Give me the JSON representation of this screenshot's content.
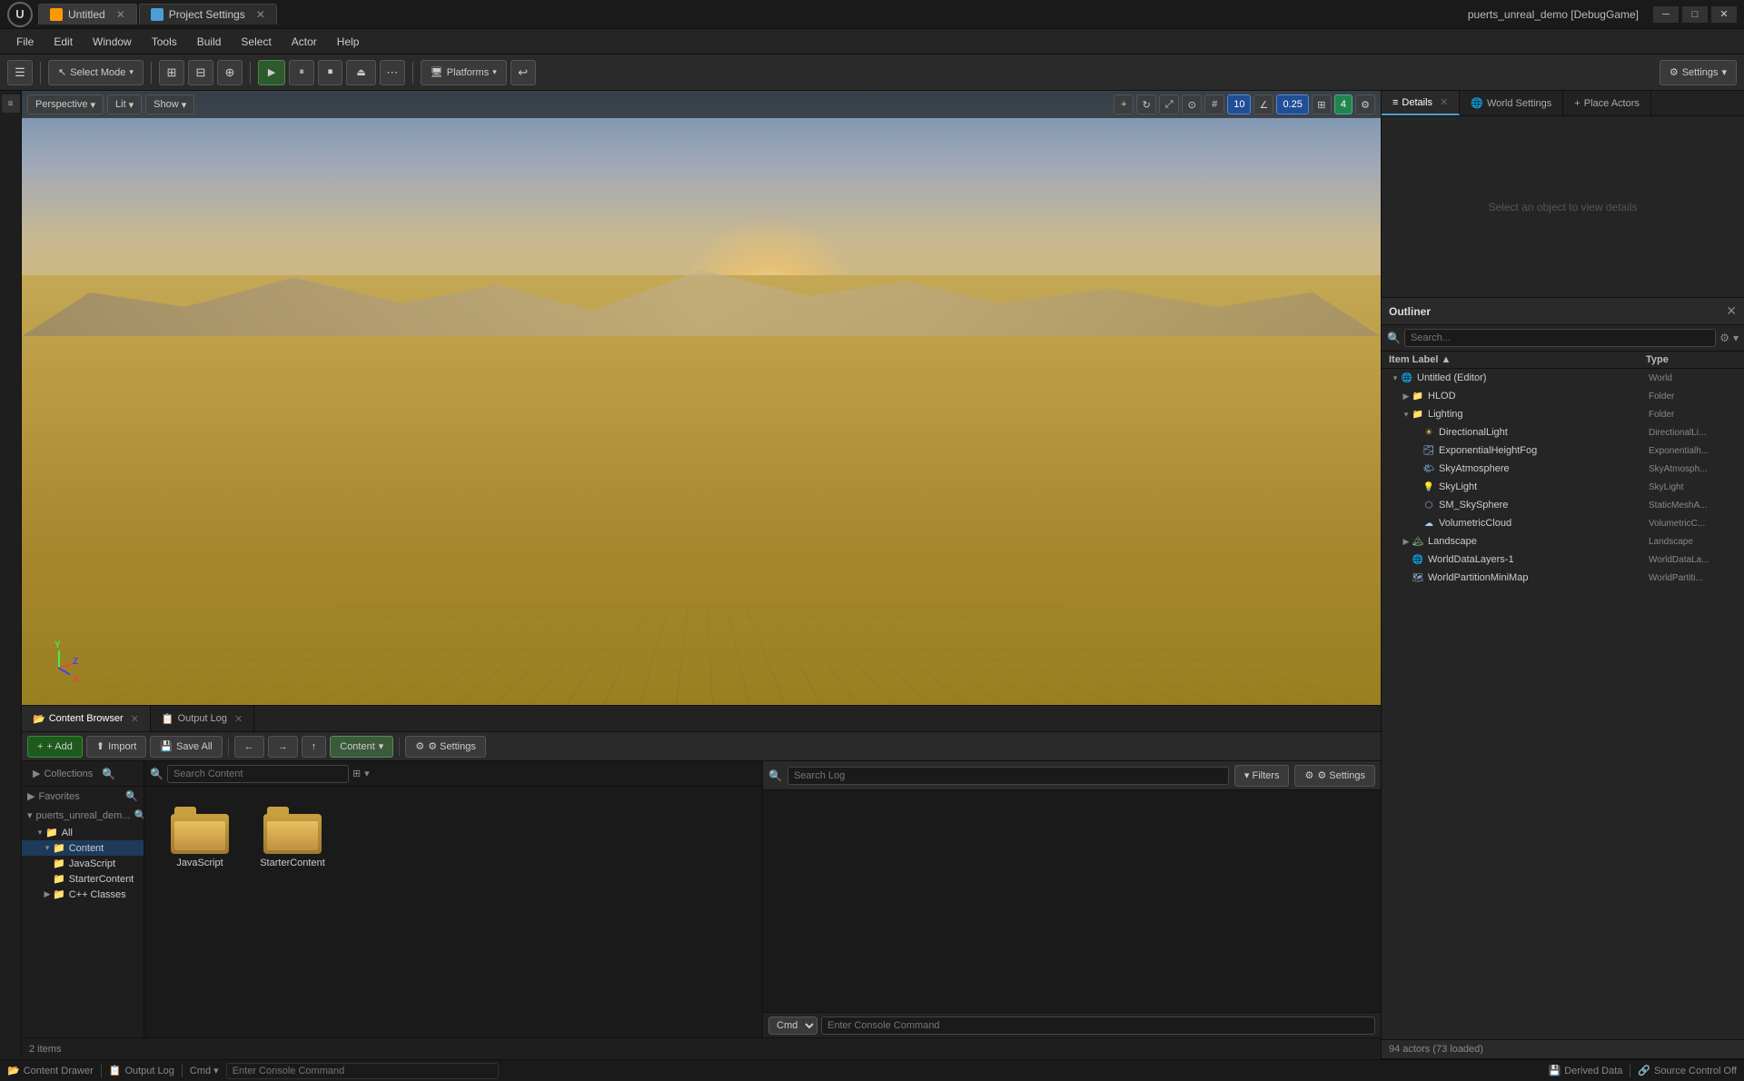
{
  "titlebar": {
    "logo": "U",
    "app_title": "puerts_unreal_demo [DebugGame]",
    "tabs": [
      {
        "label": "Untitled",
        "icon": "orange",
        "active": true
      },
      {
        "label": "Project Settings",
        "icon": "blue",
        "active": false
      }
    ],
    "window_controls": {
      "minimize": "─",
      "maximize": "□",
      "close": "✕"
    }
  },
  "menubar": {
    "items": [
      "File",
      "Edit",
      "Window",
      "Tools",
      "Build",
      "Select",
      "Actor",
      "Help"
    ]
  },
  "toolbar": {
    "select_mode_label": "Select Mode",
    "select_mode_arrow": "▾",
    "layout_btn": "⊞",
    "settings_label": "⚙ Settings",
    "platforms_label": "Platforms",
    "platforms_arrow": "▾",
    "undo_icon": "↩",
    "play_icon": "▶",
    "pause_icon": "⏸",
    "stop_icon": "⏹",
    "eject_icon": "⏏",
    "options_icon": "⋯"
  },
  "viewport": {
    "perspective_label": "Perspective",
    "lit_label": "Lit",
    "show_label": "Show",
    "num1": "10",
    "num2": "0.25",
    "num3": "4"
  },
  "outliner": {
    "title": "Outliner",
    "search_placeholder": "Search...",
    "col_label": "Item Label ▲",
    "col_type": "Type",
    "items": [
      {
        "indent": 0,
        "arrow": "▾",
        "icon": "🌐",
        "label": "Untitled (Editor)",
        "type": "World",
        "expanded": true
      },
      {
        "indent": 1,
        "arrow": "▶",
        "icon": "📁",
        "label": "HLOD",
        "type": "Folder",
        "expanded": false
      },
      {
        "indent": 1,
        "arrow": "▾",
        "icon": "📁",
        "label": "Lighting",
        "type": "Folder",
        "expanded": true
      },
      {
        "indent": 2,
        "arrow": "",
        "icon": "💡",
        "label": "DirectionalLight",
        "type": "DirectionalLi..."
      },
      {
        "indent": 2,
        "arrow": "",
        "icon": "💡",
        "label": "ExponentialHeightFog",
        "type": "Exponentialh..."
      },
      {
        "indent": 2,
        "arrow": "",
        "icon": "🌤",
        "label": "SkyAtmosphere",
        "type": "SkyAtmosph..."
      },
      {
        "indent": 2,
        "arrow": "",
        "icon": "💡",
        "label": "SkyLight",
        "type": "SkyLight"
      },
      {
        "indent": 2,
        "arrow": "",
        "icon": "⚪",
        "label": "SM_SkySphere",
        "type": "StaticMeshA..."
      },
      {
        "indent": 2,
        "arrow": "",
        "icon": "☁",
        "label": "VolumetricCloud",
        "type": "VolumetricC..."
      },
      {
        "indent": 1,
        "arrow": "▶",
        "icon": "🏔",
        "label": "Landscape",
        "type": "Landscape"
      },
      {
        "indent": 1,
        "arrow": "",
        "icon": "🌐",
        "label": "WorldDataLayers-1",
        "type": "WorldDataLa..."
      },
      {
        "indent": 1,
        "arrow": "",
        "icon": "🗺",
        "label": "WorldPartitionMiniMap",
        "type": "WorldPartiti..."
      }
    ],
    "footer": "94 actors (73 loaded)"
  },
  "details_panel": {
    "title": "Details",
    "empty_msg": "Select an object to view details"
  },
  "world_settings": {
    "title": "World Settings"
  },
  "place_actors": {
    "title": "Place Actors"
  },
  "content_browser": {
    "title": "Content Browser",
    "toolbar": {
      "add_label": "+ Add",
      "import_label": "Import",
      "save_all_label": "Save All",
      "settings_label": "⚙ Settings",
      "path_label": "Content"
    },
    "search_placeholder": "Search Content",
    "tree": {
      "favorites_label": "Favorites",
      "project_label": "puerts_unreal_dem...",
      "items": [
        {
          "indent": 0,
          "label": "All",
          "icon": "📁",
          "expanded": true
        },
        {
          "indent": 1,
          "label": "Content",
          "icon": "📁",
          "selected": true,
          "expanded": true
        },
        {
          "indent": 2,
          "label": "JavaScript",
          "icon": "📁"
        },
        {
          "indent": 2,
          "label": "StarterContent",
          "icon": "📁"
        },
        {
          "indent": 1,
          "label": "C++ Classes",
          "icon": "📁"
        }
      ]
    },
    "folders": [
      {
        "name": "JavaScript"
      },
      {
        "name": "StarterContent"
      }
    ],
    "item_count": "2 items"
  },
  "output_log": {
    "title": "Output Log",
    "search_placeholder": "Search Log",
    "filters_label": "▾ Filters",
    "settings_label": "⚙ Settings",
    "cmd_placeholder": "Enter Console Command",
    "cmd_label": "Cmd"
  },
  "statusbar": {
    "content_drawer": "Content Drawer",
    "output_log": "Output Log",
    "cmd_label": "Cmd ▾",
    "cmd_placeholder": "Enter Console Command",
    "derived_data": "Derived Data",
    "source_control": "Source Control Off"
  },
  "collections": {
    "title": "Collections"
  },
  "colors": {
    "accent_blue": "#4a9fd4",
    "accent_orange": "#f90",
    "folder_color": "#c8a040",
    "selected_bg": "#1e4070",
    "panel_bg": "#252525",
    "toolbar_bg": "#2a2a2a"
  }
}
